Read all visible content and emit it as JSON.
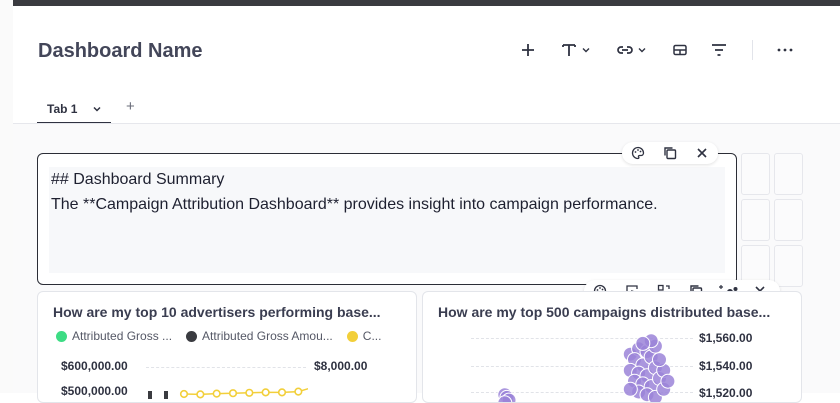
{
  "header": {
    "title": "Dashboard Name",
    "tools": [
      "plus-icon",
      "text-icon",
      "link-icon",
      "section-icon",
      "filter-icon",
      "more-icon"
    ]
  },
  "tabs": [
    {
      "label": "Tab 1",
      "active": true
    }
  ],
  "add_tab_label": "+",
  "text_card": {
    "line1": "## Dashboard Summary",
    "line2": "The **Campaign Attribution Dashboard** provides insight into campaign performance.",
    "toolbar": [
      "palette-icon",
      "duplicate-icon",
      "close-icon"
    ]
  },
  "chart_toolbar": [
    "palette-icon",
    "select-icon",
    "swap-icon",
    "duplicate-icon",
    "sparkle-icon",
    "close-icon"
  ],
  "charts": [
    {
      "title": "How are my top 10 advertisers performing base...",
      "legend": [
        {
          "label": "Attributed Gross ...",
          "color": "#3ddc84"
        },
        {
          "label": "Attributed Gross Amou...",
          "color": "#3a3b40"
        },
        {
          "label": "C...",
          "color": "#f2cf3a"
        }
      ],
      "left_ticks": [
        "$600,000.00",
        "$500,000.00"
      ],
      "right_ticks": [
        "$8,000.00"
      ]
    },
    {
      "title": "How are my top 500 campaigns distributed base...",
      "right_ticks": [
        "$1,560.00",
        "$1,540.00",
        "$1,520.00"
      ]
    }
  ],
  "chart_data": [
    {
      "type": "line",
      "title": "How are my top 10 advertisers performing base...",
      "series": [
        {
          "name": "C...",
          "color": "#f2cf3a",
          "values": [
            7200,
            7190,
            7210,
            7220,
            7230,
            7240,
            7240,
            7260,
            7380,
            7480
          ]
        }
      ],
      "ylabel_ticks_left": [
        "$600,000.00",
        "$500,000.00"
      ],
      "ylabel_ticks_right": [
        "$8,000.00"
      ]
    },
    {
      "type": "scatter",
      "title": "How are my top 500 campaigns distributed base...",
      "series": [
        {
          "color": "#9b84d8",
          "points": [
            [
              1,
              1518
            ],
            [
              1.05,
              1516
            ],
            [
              1.1,
              1514
            ],
            [
              1.0,
              1512
            ],
            [
              4.0,
              1548
            ],
            [
              4.2,
              1552
            ],
            [
              4.4,
              1550
            ],
            [
              4.1,
              1544
            ],
            [
              4.3,
              1540
            ],
            [
              4.5,
              1546
            ],
            [
              4.0,
              1536
            ],
            [
              4.2,
              1534
            ],
            [
              4.4,
              1532
            ],
            [
              4.6,
              1538
            ],
            [
              4.1,
              1528
            ],
            [
              4.3,
              1526
            ],
            [
              4.5,
              1524
            ],
            [
              4.7,
              1530
            ],
            [
              4.8,
              1536
            ],
            [
              4.2,
              1520
            ],
            [
              4.4,
              1518
            ],
            [
              4.6,
              1516
            ],
            [
              4.8,
              1522
            ],
            [
              4.9,
              1528
            ],
            [
              4.0,
              1522
            ],
            [
              4.7,
              1544
            ],
            [
              4.6,
              1554
            ],
            [
              4.5,
              1558
            ],
            [
              4.3,
              1556
            ]
          ]
        }
      ],
      "ylabel_ticks_right": [
        "$1,560.00",
        "$1,540.00",
        "$1,520.00"
      ]
    }
  ]
}
